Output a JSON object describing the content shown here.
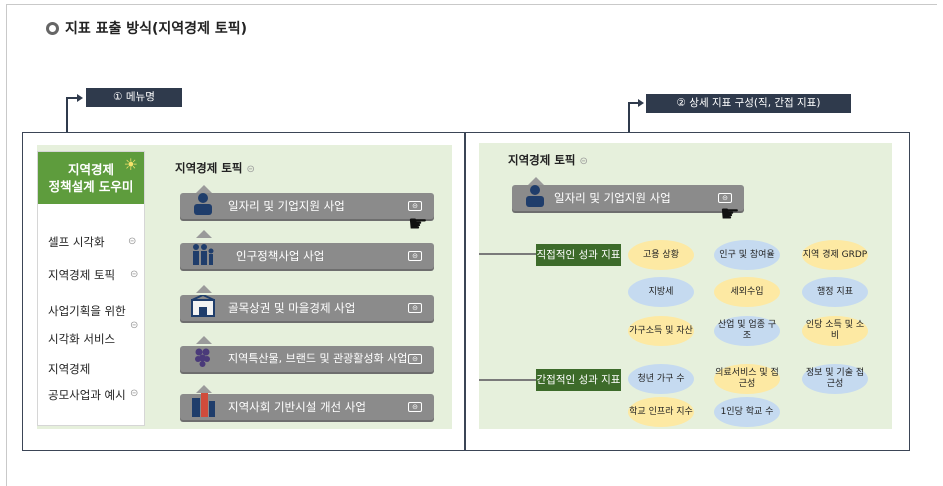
{
  "section": {
    "title": "지표 표출 방식(지역경제 토픽)"
  },
  "callouts": {
    "menu": "① 메뉴명",
    "detail": "② 상세 지표 구성(직, 간접 지표)"
  },
  "sidebar": {
    "header_line1": "지역경제",
    "header_line2": "정책설계 도우미",
    "items": [
      {
        "line1": "셀프 시각화",
        "line2": "",
        "toggle": "⊝"
      },
      {
        "line1": "지역경제 토픽",
        "line2": "",
        "toggle": "⊝"
      },
      {
        "line1": "사업기획을 위한",
        "line2": "시각화 서비스",
        "toggle": "⊝"
      },
      {
        "line1": "지역경제",
        "line2": "공모사업과 예시",
        "toggle": "⊝"
      }
    ]
  },
  "left_panel": {
    "topic_title": "지역경제 토픽",
    "topic_toggle": "⊝",
    "bars": [
      {
        "label": "일자리 및 기업지원 사업",
        "icon": "worker-icon"
      },
      {
        "label": "인구정책사업 사업",
        "icon": "family-icon"
      },
      {
        "label": "골목상권 및 마을경제 사업",
        "icon": "store-icon"
      },
      {
        "label": "지역특산물, 브랜드 및 관광활성화 사업",
        "icon": "grape-icon"
      },
      {
        "label": "지역사회 기반시설 개선 사업",
        "icon": "building-icon"
      }
    ],
    "bar_toggle": "⊝"
  },
  "right_panel": {
    "topic_title": "지역경제 토픽",
    "topic_toggle": "⊝",
    "selected_bar": "일자리 및 기업지원 사업",
    "direct_tag": "직접적인 성과 지표",
    "indirect_tag": "간접적인 성과 지표",
    "direct_indicators": [
      [
        "고용 상황",
        "인구 및 참여율",
        "지역 경제 GRDP"
      ],
      [
        "지방세",
        "세외수입",
        "행정 지표"
      ],
      [
        "가구소득 및 자산",
        "산업 및 업종 구조",
        "인당 소득 및 소비"
      ]
    ],
    "indirect_indicators": [
      [
        "청년 가구 수",
        "의료서비스 및 접근성",
        "정보 및 기술 접근성"
      ],
      [
        "학교 인프라 지수",
        "1인당 학교 수"
      ]
    ]
  },
  "colors": {
    "green_header": "#5e9c3d",
    "tag_green": "#3d6b2a",
    "bar_gray": "#8b8b8b",
    "panel_bg": "#e6f0dc",
    "navy": "#2f3a4c"
  }
}
